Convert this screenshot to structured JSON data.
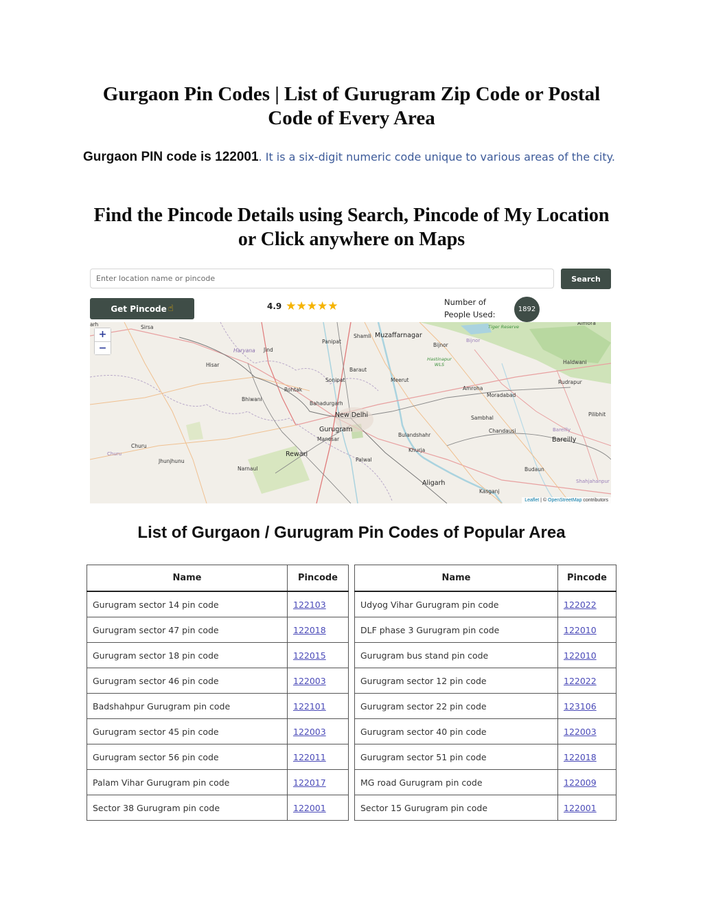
{
  "header": {
    "title": "Gurgaon Pin Codes | List of Gurugram Zip Code or Postal Code of Every Area",
    "intro_lead": "Gurgaon PIN code is 122001",
    "intro_rest": ". It is a six-digit numeric code unique to various areas of the city.",
    "finder_title": "Find the Pincode Details using Search, Pincode of My Location or Click anywhere on Maps"
  },
  "widget": {
    "search_placeholder": "Enter location name or pincode",
    "search_value": "",
    "search_label": "Search",
    "get_pincode_label": "Get Pincode",
    "get_pincode_icon": "pointing-hand-icon",
    "rating_value": "4.9",
    "rating_stars_glyphs": "★★★★★",
    "rating_fraction": 0.9,
    "users_label": "Number of People Used:",
    "users_count": "1892",
    "accent_color": "#3f4d47",
    "star_color": "#f5b301"
  },
  "map": {
    "zoom_in_label": "+",
    "zoom_out_label": "−",
    "attribution_leaflet": "Leaflet",
    "attribution_sep": " | © ",
    "attribution_osm": "OpenStreetMap",
    "attribution_rest": " contributors",
    "labels": {
      "sirsa": "Sirsa",
      "panipat": "Panipat",
      "shamli": "Shamli",
      "muzaffarnagar": "Muzaffarnagar",
      "bijnor": "Bijnor",
      "bijnor_district": "Bijnor",
      "tiger_reserve": "Tiger Reserve",
      "almora": "Almora",
      "haryana": "Haryana",
      "jind": "Jind",
      "hisar": "Hisar",
      "hastinapur": "Hastinapur WLS",
      "haldwani": "Haldwani",
      "baraut": "Baraut",
      "sonipat": "Sonipat",
      "meerut": "Meerut",
      "rohtak": "Rohtak",
      "amroha": "Amroha",
      "rudrapur": "Rudrapur",
      "moradabad": "Moradabad",
      "bhiwani": "Bhiwani",
      "bahadurgarh": "Bahadurgarh",
      "new_delhi": "New Delhi",
      "sambhal": "Sambhal",
      "pilibhit": "Pilibhit",
      "gurugram": "Gurugram",
      "manesar": "Manesar",
      "bulandshahr": "Bulandshahr",
      "chandausi": "Chandausi",
      "bareilly_district": "Bareilly",
      "bareilly": "Bareilly",
      "churu": "Churu",
      "churu_district": "Churu",
      "khurja": "Khurja",
      "rewari": "Rewari",
      "jhunjhunu": "Jhunjhunu",
      "palwal": "Palwal",
      "narnaul": "Narnaul",
      "budaun": "Budaun",
      "aligarh": "Aligarh",
      "shahjahanpur": "Shahjahanpur",
      "kasganj": "Kasganj",
      "edge_left": "arh"
    }
  },
  "pin_section": {
    "title": "List of Gurgaon / Gurugram Pin Codes of Popular Area",
    "col_name": "Name",
    "col_pincode": "Pincode",
    "left_rows": [
      {
        "name": "Gurugram sector 14 pin code",
        "pincode": "122103"
      },
      {
        "name": "Gurugram sector 47 pin code",
        "pincode": "122018"
      },
      {
        "name": "Gurugram sector 18 pin code",
        "pincode": "122015"
      },
      {
        "name": "Gurugram sector 46 pin code",
        "pincode": "122003"
      },
      {
        "name": "Badshahpur Gurugram pin code",
        "pincode": "122101"
      },
      {
        "name": "Gurugram sector 45 pin code",
        "pincode": "122003"
      },
      {
        "name": "Gurugram sector 56 pin code",
        "pincode": "122011"
      },
      {
        "name": "Palam Vihar Gurugram pin code",
        "pincode": "122017"
      },
      {
        "name": "Sector 38 Gurugram pin code",
        "pincode": "122001"
      }
    ],
    "right_rows": [
      {
        "name": "Udyog Vihar Gurugram pin code",
        "pincode": "122022"
      },
      {
        "name": "DLF phase 3 Gurugram pin code",
        "pincode": "122010"
      },
      {
        "name": "Gurugram bus stand pin code",
        "pincode": "122010"
      },
      {
        "name": "Gurugram sector 12 pin code",
        "pincode": "122022"
      },
      {
        "name": "Gurugram sector 22 pin code",
        "pincode": "123106"
      },
      {
        "name": "Gurugram sector 40 pin code",
        "pincode": "122003"
      },
      {
        "name": "Gurugram sector 51 pin code",
        "pincode": "122018"
      },
      {
        "name": "MG road Gurugram pin code",
        "pincode": "122009"
      },
      {
        "name": "Sector 15 Gurugram pin code",
        "pincode": "122001"
      }
    ]
  }
}
